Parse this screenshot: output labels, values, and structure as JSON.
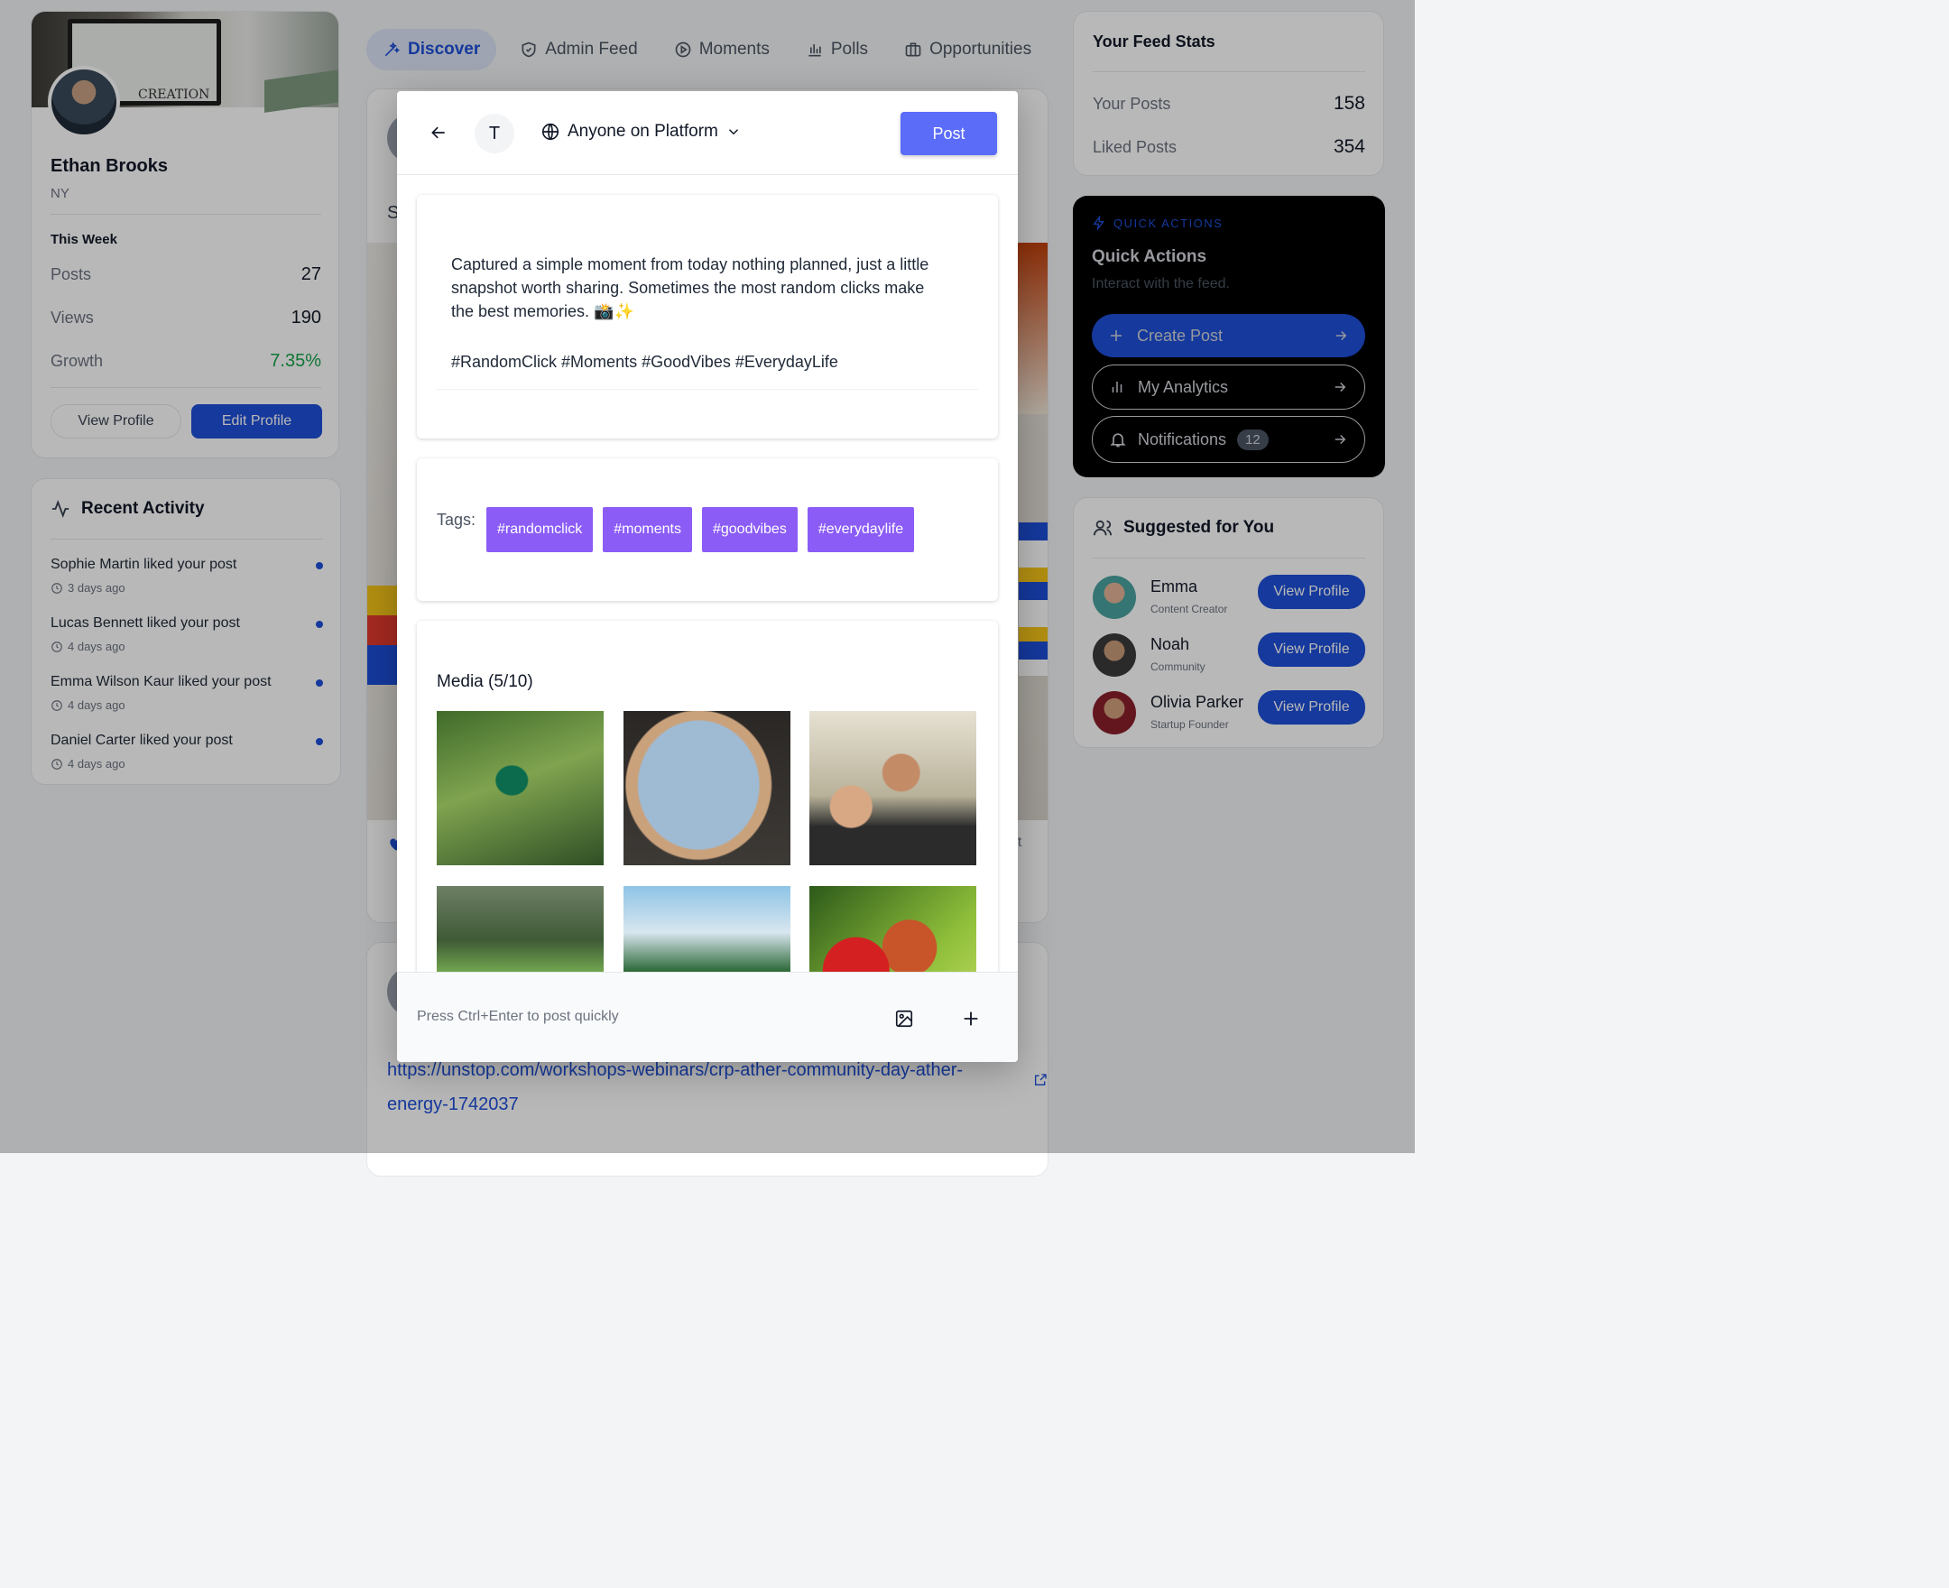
{
  "profile": {
    "name": "Ethan Brooks",
    "location": "NY",
    "cover_text": "CREATION",
    "week_title": "This Week",
    "stats": [
      {
        "label": "Posts",
        "value": "27"
      },
      {
        "label": "Views",
        "value": "190"
      },
      {
        "label": "Growth",
        "value": "7.35%"
      }
    ],
    "view_profile_label": "View Profile",
    "edit_profile_label": "Edit Profile"
  },
  "recent_activity": {
    "title": "Recent Activity",
    "items": [
      {
        "text": "Sophie Martin liked your post",
        "time": "3 days ago"
      },
      {
        "text": "Lucas Bennett liked your post",
        "time": "4 days ago"
      },
      {
        "text": "Emma Wilson Kaur liked your post",
        "time": "4 days ago"
      },
      {
        "text": "Daniel Carter liked your post",
        "time": "4 days ago"
      }
    ]
  },
  "tabs": [
    {
      "label": "Discover",
      "icon": "wand-icon",
      "active": true
    },
    {
      "label": "Admin Feed",
      "icon": "shield-icon"
    },
    {
      "label": "Moments",
      "icon": "play-circle-icon"
    },
    {
      "label": "Polls",
      "icon": "bar-chart-icon"
    },
    {
      "label": "Opportunities",
      "icon": "briefcase-icon"
    }
  ],
  "feed": {
    "link_line1": "https://unstop.com/workshops-webinars/crp-ather-community-day-ather-",
    "link_line2": "energy-1742037",
    "partial_s": "S",
    "partial_nt": "nt"
  },
  "feed_stats": {
    "title": "Your Feed Stats",
    "rows": [
      {
        "label": "Your Posts",
        "value": "158"
      },
      {
        "label": "Liked Posts",
        "value": "354"
      }
    ]
  },
  "quick_actions": {
    "eyebrow": "QUICK ACTIONS",
    "title": "Quick Actions",
    "subtitle": "Interact with the feed.",
    "create_label": "Create Post",
    "analytics_label": "My Analytics",
    "notifications_label": "Notifications",
    "notifications_count": "12"
  },
  "suggested": {
    "title": "Suggested for You",
    "button_label": "View Profile",
    "people": [
      {
        "name": "Emma",
        "role": "Content Creator"
      },
      {
        "name": "Noah",
        "role": "Community"
      },
      {
        "name": "Olivia Parker",
        "role": "Startup Founder"
      }
    ]
  },
  "composer": {
    "avatar_letter": "T",
    "audience": "Anyone on Platform",
    "post_label": "Post",
    "text_line1": "Captured a simple moment from today nothing planned, just a little",
    "text_line2": "snapshot worth sharing. Sometimes the most random clicks make",
    "text_line3": "the best memories. 📸✨",
    "hashtags": "#RandomClick #Moments #GoodVibes #EverydayLife",
    "tags_label": "Tags:",
    "tags": [
      "#randomclick",
      "#moments",
      "#goodvibes",
      "#everydaylife"
    ],
    "media_title": "Media (5/10)",
    "media": [
      "hummingbird on branch",
      "airplane window view",
      "father hugging child",
      "motion blur cyclist",
      "stadium with Brazil flag",
      "ladybug on grass"
    ],
    "footer_hint": "Press Ctrl+Enter to post quickly"
  },
  "colors": {
    "primary": "#1e4fd8",
    "accent_purple": "#8b5cf6",
    "post_button": "#5b6cf9",
    "growth_green": "#16a34a",
    "dark_card": "#000000"
  }
}
